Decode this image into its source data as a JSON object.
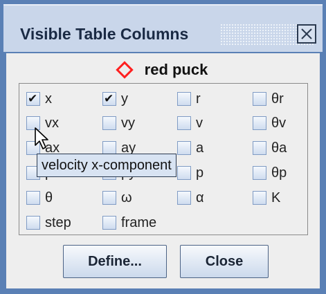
{
  "window": {
    "title": "Visible Table Columns",
    "close_icon": "close-x-icon"
  },
  "track": {
    "name": "red puck",
    "marker_icon": "diamond-icon",
    "marker_color": "#ff2020"
  },
  "columns": [
    {
      "label": "x",
      "checked": true
    },
    {
      "label": "y",
      "checked": true
    },
    {
      "label": "r",
      "checked": false
    },
    {
      "label": "θr",
      "checked": false
    },
    {
      "label": "vx",
      "checked": false
    },
    {
      "label": "vy",
      "checked": false
    },
    {
      "label": "v",
      "checked": false
    },
    {
      "label": "θv",
      "checked": false
    },
    {
      "label": "ax",
      "checked": false
    },
    {
      "label": "ay",
      "checked": false
    },
    {
      "label": "a",
      "checked": false
    },
    {
      "label": "θa",
      "checked": false
    },
    {
      "label": "px",
      "checked": false
    },
    {
      "label": "py",
      "checked": false
    },
    {
      "label": "p",
      "checked": false
    },
    {
      "label": "θp",
      "checked": false
    },
    {
      "label": "θ",
      "checked": false
    },
    {
      "label": "ω",
      "checked": false
    },
    {
      "label": "α",
      "checked": false
    },
    {
      "label": "K",
      "checked": false
    },
    {
      "label": "step",
      "checked": false
    },
    {
      "label": "frame",
      "checked": false
    }
  ],
  "tooltip": {
    "text": "velocity x-component"
  },
  "buttons": {
    "define_label": "Define...",
    "close_label": "Close"
  },
  "icons": {
    "checkmark": "checkmark-icon",
    "cursor": "mouse-pointer-icon"
  }
}
